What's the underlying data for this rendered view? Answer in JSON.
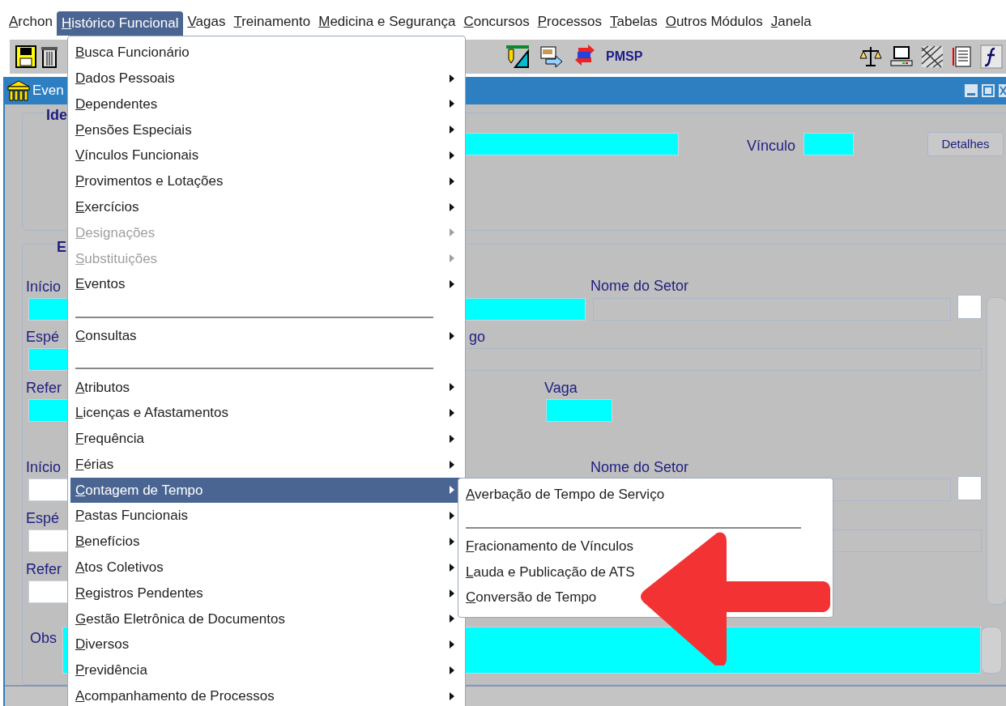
{
  "menu_bar": [
    {
      "label": "Archon",
      "selected": false
    },
    {
      "label": "Histórico Funcional",
      "selected": true
    },
    {
      "label": "Vagas",
      "selected": false
    },
    {
      "label": "Treinamento",
      "selected": false
    },
    {
      "label": "Medicina e Segurança",
      "selected": false
    },
    {
      "label": "Concursos",
      "selected": false
    },
    {
      "label": "Processos",
      "selected": false
    },
    {
      "label": "Tabelas",
      "selected": false
    },
    {
      "label": "Outros Módulos",
      "selected": false
    },
    {
      "label": "Janela",
      "selected": false
    }
  ],
  "toolbar": {
    "label": "PMSP"
  },
  "window": {
    "title": "Even"
  },
  "form": {
    "frame_1_title": "Ide",
    "vinculo_label": "Vínculo",
    "details_button": "Detalhes",
    "frame_2_title": "E",
    "upper_group": {
      "start_label": "Início",
      "sector_label": "Nome do Setor",
      "species_label": "Espé",
      "species_right_label": "go",
      "reference_label": "Refer",
      "vacancy_label": "Vaga"
    },
    "lower_group": {
      "start_label": "Início",
      "sector_label": "Nome do Setor",
      "species_label": "Espé",
      "reference_label": "Refer"
    },
    "obs_label": "Obs"
  },
  "menu": {
    "items": [
      {
        "kind": "item",
        "label": "Busca Funcionário",
        "submenu": false,
        "disabled": false,
        "selected": false
      },
      {
        "kind": "item",
        "label": "Dados Pessoais",
        "submenu": true,
        "disabled": false,
        "selected": false
      },
      {
        "kind": "item",
        "label": "Dependentes",
        "submenu": true,
        "disabled": false,
        "selected": false
      },
      {
        "kind": "item",
        "label": "Pensões Especiais",
        "submenu": true,
        "disabled": false,
        "selected": false
      },
      {
        "kind": "item",
        "label": "Vínculos Funcionais",
        "submenu": true,
        "disabled": false,
        "selected": false
      },
      {
        "kind": "item",
        "label": "Provimentos e Lotações",
        "submenu": true,
        "disabled": false,
        "selected": false
      },
      {
        "kind": "item",
        "label": "Exercícios",
        "submenu": true,
        "disabled": false,
        "selected": false
      },
      {
        "kind": "item",
        "label": "Designações",
        "submenu": true,
        "disabled": true,
        "selected": false
      },
      {
        "kind": "item",
        "label": "Substituições",
        "submenu": true,
        "disabled": true,
        "selected": false
      },
      {
        "kind": "item",
        "label": "Eventos",
        "submenu": true,
        "disabled": false,
        "selected": false
      },
      {
        "kind": "separator"
      },
      {
        "kind": "item",
        "label": "Consultas",
        "submenu": true,
        "disabled": false,
        "selected": false
      },
      {
        "kind": "separator"
      },
      {
        "kind": "item",
        "label": "Atributos",
        "submenu": true,
        "disabled": false,
        "selected": false
      },
      {
        "kind": "item",
        "label": "Licenças e Afastamentos",
        "submenu": true,
        "disabled": false,
        "selected": false
      },
      {
        "kind": "item",
        "label": "Frequência",
        "submenu": true,
        "disabled": false,
        "selected": false
      },
      {
        "kind": "item",
        "label": "Férias",
        "submenu": true,
        "disabled": false,
        "selected": false
      },
      {
        "kind": "item",
        "label": "Contagem de Tempo",
        "submenu": true,
        "disabled": false,
        "selected": true
      },
      {
        "kind": "item",
        "label": "Pastas Funcionais",
        "submenu": true,
        "disabled": false,
        "selected": false
      },
      {
        "kind": "item",
        "label": "Benefícios",
        "submenu": true,
        "disabled": false,
        "selected": false
      },
      {
        "kind": "item",
        "label": "Atos Coletivos",
        "submenu": true,
        "disabled": false,
        "selected": false
      },
      {
        "kind": "item",
        "label": "Registros Pendentes",
        "submenu": true,
        "disabled": false,
        "selected": false
      },
      {
        "kind": "item",
        "label": "Gestão Eletrônica de Documentos",
        "submenu": true,
        "disabled": false,
        "selected": false
      },
      {
        "kind": "item",
        "label": "Diversos",
        "submenu": true,
        "disabled": false,
        "selected": false
      },
      {
        "kind": "item",
        "label": "Previdência",
        "submenu": true,
        "disabled": false,
        "selected": false
      },
      {
        "kind": "item",
        "label": "Acompanhamento de Processos",
        "submenu": true,
        "disabled": false,
        "selected": false
      }
    ]
  },
  "submenu": {
    "items": [
      {
        "kind": "item",
        "label": "Averbação de Tempo de Serviço"
      },
      {
        "kind": "separator"
      },
      {
        "kind": "item",
        "label": "Fracionamento de Vínculos"
      },
      {
        "kind": "item",
        "label": "Lauda e Publicação de ATS"
      },
      {
        "kind": "item",
        "label": "Conversão de Tempo"
      }
    ]
  }
}
